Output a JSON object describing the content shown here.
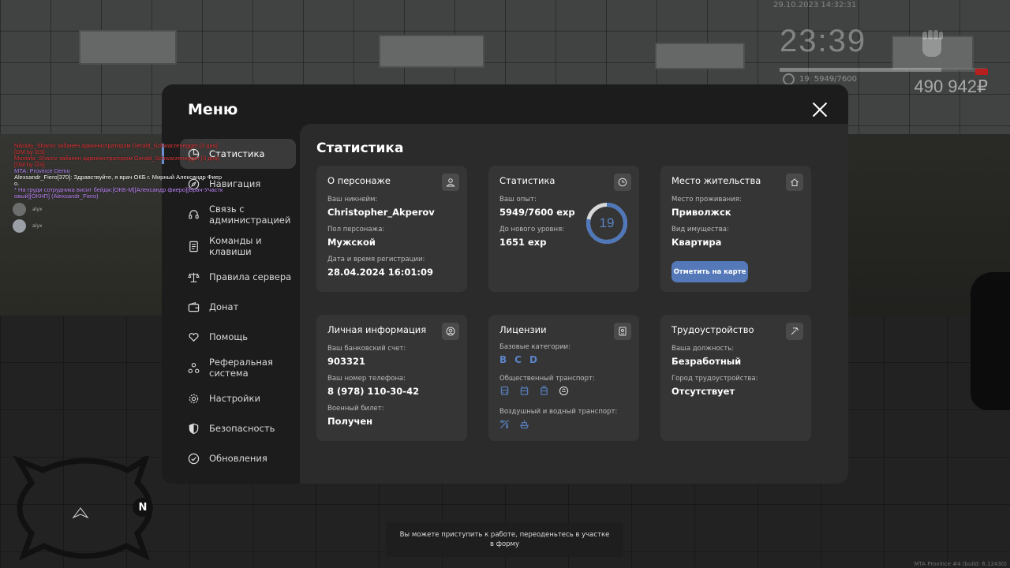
{
  "hud": {
    "date": "29.10.2023 14:32:31",
    "time": "23:39",
    "level": "19",
    "exp": "5949/7600",
    "exp_fraction": 0.783,
    "money": "490 942₽"
  },
  "chat": [
    {
      "text": "Nikolay_Sharov забанен администратором Gerald_Schwarzenegger [3 дня]",
      "color": "#e23b3b"
    },
    {
      "text": "[DM by GS]",
      "color": "#e23b3b"
    },
    {
      "text": "Mustafa_Sharov забанен администратором Gerald_Schwarzenegger [3 дня]",
      "color": "#e23b3b"
    },
    {
      "text": "[DM by GS]",
      "color": "#e23b3b"
    },
    {
      "text": "MTA: Province Demo",
      "color": "#b58cff"
    },
    {
      "text": "Alexsandr_Fiero[370]: Здравствуйте, я врач ОКБ г. Мирный Александр Фиер",
      "color": "#ffffff",
      "prefix_color": "#e87a3a"
    },
    {
      "text": "о.",
      "color": "#ffffff"
    },
    {
      "text": "* На груди сотрудника висит бейдж:[ОКБ-М][Александр фиеро][Врач-Участк",
      "color": "#c58cff"
    },
    {
      "text": "овый][ОКНП] (Alexsandr_Fiero)",
      "color": "#c58cff"
    }
  ],
  "players": [
    {
      "name": "alyx"
    },
    {
      "name": "alyx"
    }
  ],
  "menu": {
    "title": "Меню",
    "nav": [
      {
        "label": "Статистика",
        "icon": "pie-chart-icon"
      },
      {
        "label": "Навигация",
        "icon": "compass-icon"
      },
      {
        "label": "Связь с администрацией",
        "icon": "headset-icon"
      },
      {
        "label": "Команды и клавиши",
        "icon": "document-icon"
      },
      {
        "label": "Правила сервера",
        "icon": "scales-icon"
      },
      {
        "label": "Донат",
        "icon": "wallet-icon"
      },
      {
        "label": "Помощь",
        "icon": "heart-hand-icon"
      },
      {
        "label": "Реферальная система",
        "icon": "referral-icon"
      },
      {
        "label": "Настройки",
        "icon": "gear-icon"
      },
      {
        "label": "Безопасность",
        "icon": "shield-icon"
      },
      {
        "label": "Обновления",
        "icon": "check-circle-icon"
      }
    ]
  },
  "stats": {
    "title": "Статистика",
    "character": {
      "title": "О персонаже",
      "nickname_label": "Ваш никнейм:",
      "nickname": "Christopher_Akperov",
      "gender_label": "Пол персонажа:",
      "gender": "Мужской",
      "reg_label": "Дата и время регистрации:",
      "reg": "28.04.2024 16:01:09"
    },
    "statistics": {
      "title": "Статистика",
      "exp_label": "Ваш опыт:",
      "exp": "5949/7600 exp",
      "next_label": "До нового уровня:",
      "next": "1651 exp",
      "level": "19",
      "progress": 0.783
    },
    "residence": {
      "title": "Место жительства",
      "place_label": "Место проживания:",
      "place": "Приволжск",
      "property_label": "Вид имущества:",
      "property": "Квартира",
      "map_button": "Отметить на карте"
    },
    "personal": {
      "title": "Личная информация",
      "bank_label": "Ваш банковский счет:",
      "bank": "903321",
      "phone_label": "Ваш номер телефона:",
      "phone": "8 (978) 110-30-42",
      "military_label": "Военный билет:",
      "military": "Получен"
    },
    "licenses": {
      "title": "Лицензии",
      "base_label": "Базовые категории:",
      "categories": [
        "B",
        "C",
        "D"
      ],
      "public_label": "Общественный транспорт:",
      "public_icons": [
        "bus-icon",
        "trolleybus-icon",
        "tram-icon",
        "taxi-icon"
      ],
      "airwater_label": "Воздушный и водный транспорт:",
      "airwater_icons": [
        "plane-icon",
        "ship-icon"
      ]
    },
    "employment": {
      "title": "Трудоустройство",
      "position_label": "Ваша должность:",
      "position": "Безработный",
      "city_label": "Город трудоустройства:",
      "city": "Отсутствует"
    }
  },
  "notice": "Вы можете приступить к работе, переоденьтесь в участке в форму",
  "watermark": "MTA Province #4 (build: 6.12430)",
  "colors": {
    "accent": "#5478b8",
    "level": "#5b84c7",
    "panel": "#1c1c1c",
    "content": "#2b2b2b",
    "card": "#353535"
  }
}
